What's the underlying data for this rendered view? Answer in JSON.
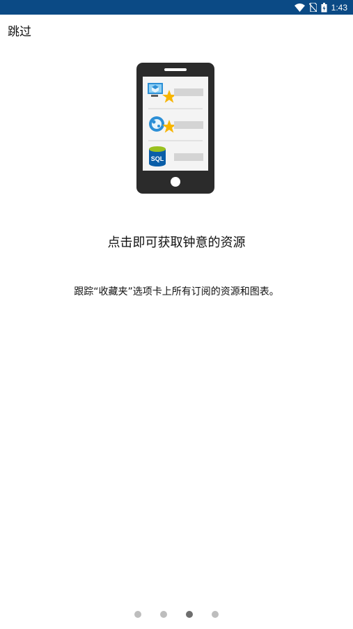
{
  "status_bar": {
    "time": "1:43",
    "icons": [
      "wifi-icon",
      "no-sim-icon",
      "battery-icon"
    ]
  },
  "skip_label": "跳过",
  "illustration": {
    "rows": [
      "vm-favorite-icon",
      "web-app-favorite-icon",
      "sql-database-icon"
    ],
    "sql_label": "SQL"
  },
  "heading": "点击即可获取钟意的资源",
  "description": "跟踪“收藏夹”选项卡上所有订阅的资源和图表。",
  "pager": {
    "pages": 4,
    "active_index": 2
  },
  "colors": {
    "status_bar": "#0b4a85",
    "star": "#f7b500",
    "azure_blue": "#2c8fd6",
    "sql_blue": "#0a5ea8",
    "sql_green": "#9ac11f",
    "phone_body": "#2b2b2b",
    "dot_inactive": "#bdbdbd",
    "dot_active": "#6e6e6e"
  }
}
